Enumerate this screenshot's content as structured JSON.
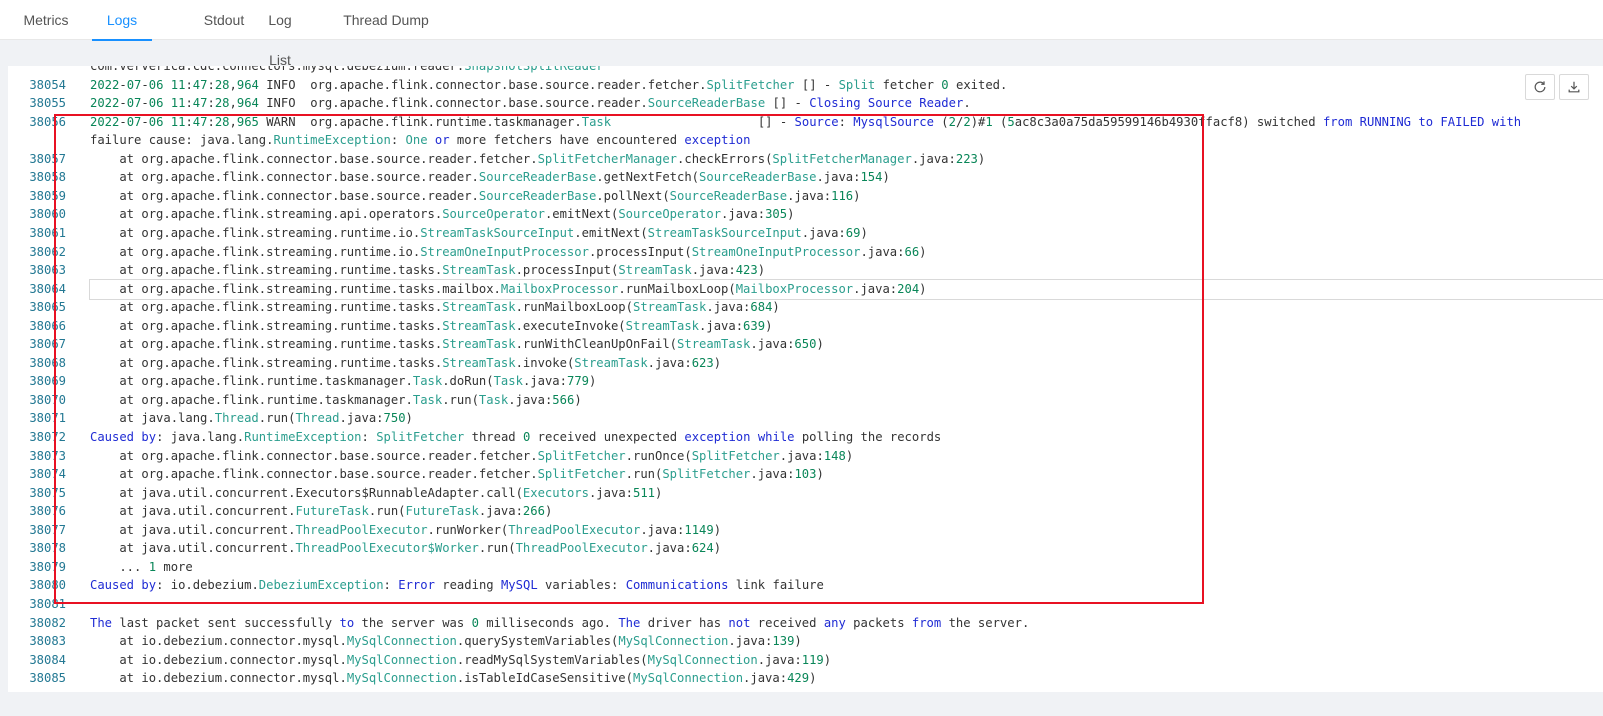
{
  "tabs": [
    {
      "label": "Metrics",
      "active": false
    },
    {
      "label": "Logs",
      "active": true
    },
    {
      "label": "Stdout",
      "active": false
    },
    {
      "label": "Log List",
      "active": false
    },
    {
      "label": "Thread Dump",
      "active": false
    }
  ],
  "actions": [
    {
      "name": "refresh-button",
      "icon": "refresh-icon"
    },
    {
      "name": "download-button",
      "icon": "download-icon"
    }
  ],
  "colors": {
    "accent": "#1890ff",
    "line_number": "#237893",
    "type_name": "#2b9e8e",
    "keyword": "#1f2bd4",
    "number": "#098658",
    "highlight_box": "#e81123"
  },
  "log_lines": [
    {
      "num": "",
      "text": "com.ververica.cdc.connectors.mysql.debezium.reader.SnapshotSplitReader"
    },
    {
      "num": "38054",
      "text": "2022-07-06 11:47:28,964 INFO  org.apache.flink.connector.base.source.reader.fetcher.SplitFetcher [] - Split fetcher 0 exited."
    },
    {
      "num": "38055",
      "text": "2022-07-06 11:47:28,964 INFO  org.apache.flink.connector.base.source.reader.SourceReaderBase [] - Closing Source Reader."
    },
    {
      "num": "38056",
      "text": "2022-07-06 11:47:28,965 WARN  org.apache.flink.runtime.taskmanager.Task                    [] - Source: MysqlSource (2/2)#1 (5ac8c3a0a75da59599146b4930ffacf8) switched from RUNNING to FAILED with"
    },
    {
      "num": "",
      "text": "failure cause: java.lang.RuntimeException: One or more fetchers have encountered exception"
    },
    {
      "num": "38057",
      "text": "    at org.apache.flink.connector.base.source.reader.fetcher.SplitFetcherManager.checkErrors(SplitFetcherManager.java:223)"
    },
    {
      "num": "38058",
      "text": "    at org.apache.flink.connector.base.source.reader.SourceReaderBase.getNextFetch(SourceReaderBase.java:154)"
    },
    {
      "num": "38059",
      "text": "    at org.apache.flink.connector.base.source.reader.SourceReaderBase.pollNext(SourceReaderBase.java:116)"
    },
    {
      "num": "38060",
      "text": "    at org.apache.flink.streaming.api.operators.SourceOperator.emitNext(SourceOperator.java:305)"
    },
    {
      "num": "38061",
      "text": "    at org.apache.flink.streaming.runtime.io.StreamTaskSourceInput.emitNext(StreamTaskSourceInput.java:69)"
    },
    {
      "num": "38062",
      "text": "    at org.apache.flink.streaming.runtime.io.StreamOneInputProcessor.processInput(StreamOneInputProcessor.java:66)"
    },
    {
      "num": "38063",
      "text": "    at org.apache.flink.streaming.runtime.tasks.StreamTask.processInput(StreamTask.java:423)"
    },
    {
      "num": "38064",
      "text": "    at org.apache.flink.streaming.runtime.tasks.mailbox.MailboxProcessor.runMailboxLoop(MailboxProcessor.java:204)",
      "cursor": true
    },
    {
      "num": "38065",
      "text": "    at org.apache.flink.streaming.runtime.tasks.StreamTask.runMailboxLoop(StreamTask.java:684)"
    },
    {
      "num": "38066",
      "text": "    at org.apache.flink.streaming.runtime.tasks.StreamTask.executeInvoke(StreamTask.java:639)"
    },
    {
      "num": "38067",
      "text": "    at org.apache.flink.streaming.runtime.tasks.StreamTask.runWithCleanUpOnFail(StreamTask.java:650)"
    },
    {
      "num": "38068",
      "text": "    at org.apache.flink.streaming.runtime.tasks.StreamTask.invoke(StreamTask.java:623)"
    },
    {
      "num": "38069",
      "text": "    at org.apache.flink.runtime.taskmanager.Task.doRun(Task.java:779)"
    },
    {
      "num": "38070",
      "text": "    at org.apache.flink.runtime.taskmanager.Task.run(Task.java:566)"
    },
    {
      "num": "38071",
      "text": "    at java.lang.Thread.run(Thread.java:750)"
    },
    {
      "num": "38072",
      "text": "Caused by: java.lang.RuntimeException: SplitFetcher thread 0 received unexpected exception while polling the records"
    },
    {
      "num": "38073",
      "text": "    at org.apache.flink.connector.base.source.reader.fetcher.SplitFetcher.runOnce(SplitFetcher.java:148)"
    },
    {
      "num": "38074",
      "text": "    at org.apache.flink.connector.base.source.reader.fetcher.SplitFetcher.run(SplitFetcher.java:103)"
    },
    {
      "num": "38075",
      "text": "    at java.util.concurrent.Executors$RunnableAdapter.call(Executors.java:511)"
    },
    {
      "num": "38076",
      "text": "    at java.util.concurrent.FutureTask.run(FutureTask.java:266)"
    },
    {
      "num": "38077",
      "text": "    at java.util.concurrent.ThreadPoolExecutor.runWorker(ThreadPoolExecutor.java:1149)"
    },
    {
      "num": "38078",
      "text": "    at java.util.concurrent.ThreadPoolExecutor$Worker.run(ThreadPoolExecutor.java:624)"
    },
    {
      "num": "38079",
      "text": "    ... 1 more"
    },
    {
      "num": "38080",
      "text": "Caused by: io.debezium.DebeziumException: Error reading MySQL variables: Communications link failure"
    },
    {
      "num": "38081",
      "text": ""
    },
    {
      "num": "38082",
      "text": "The last packet sent successfully to the server was 0 milliseconds ago. The driver has not received any packets from the server."
    },
    {
      "num": "38083",
      "text": "    at io.debezium.connector.mysql.MySqlConnection.querySystemVariables(MySqlConnection.java:139)"
    },
    {
      "num": "38084",
      "text": "    at io.debezium.connector.mysql.MySqlConnection.readMySqlSystemVariables(MySqlConnection.java:119)"
    },
    {
      "num": "38085",
      "text": "    at io.debezium.connector.mysql.MySqlConnection.isTableIdCaseSensitive(MySqlConnection.java:429)"
    }
  ]
}
